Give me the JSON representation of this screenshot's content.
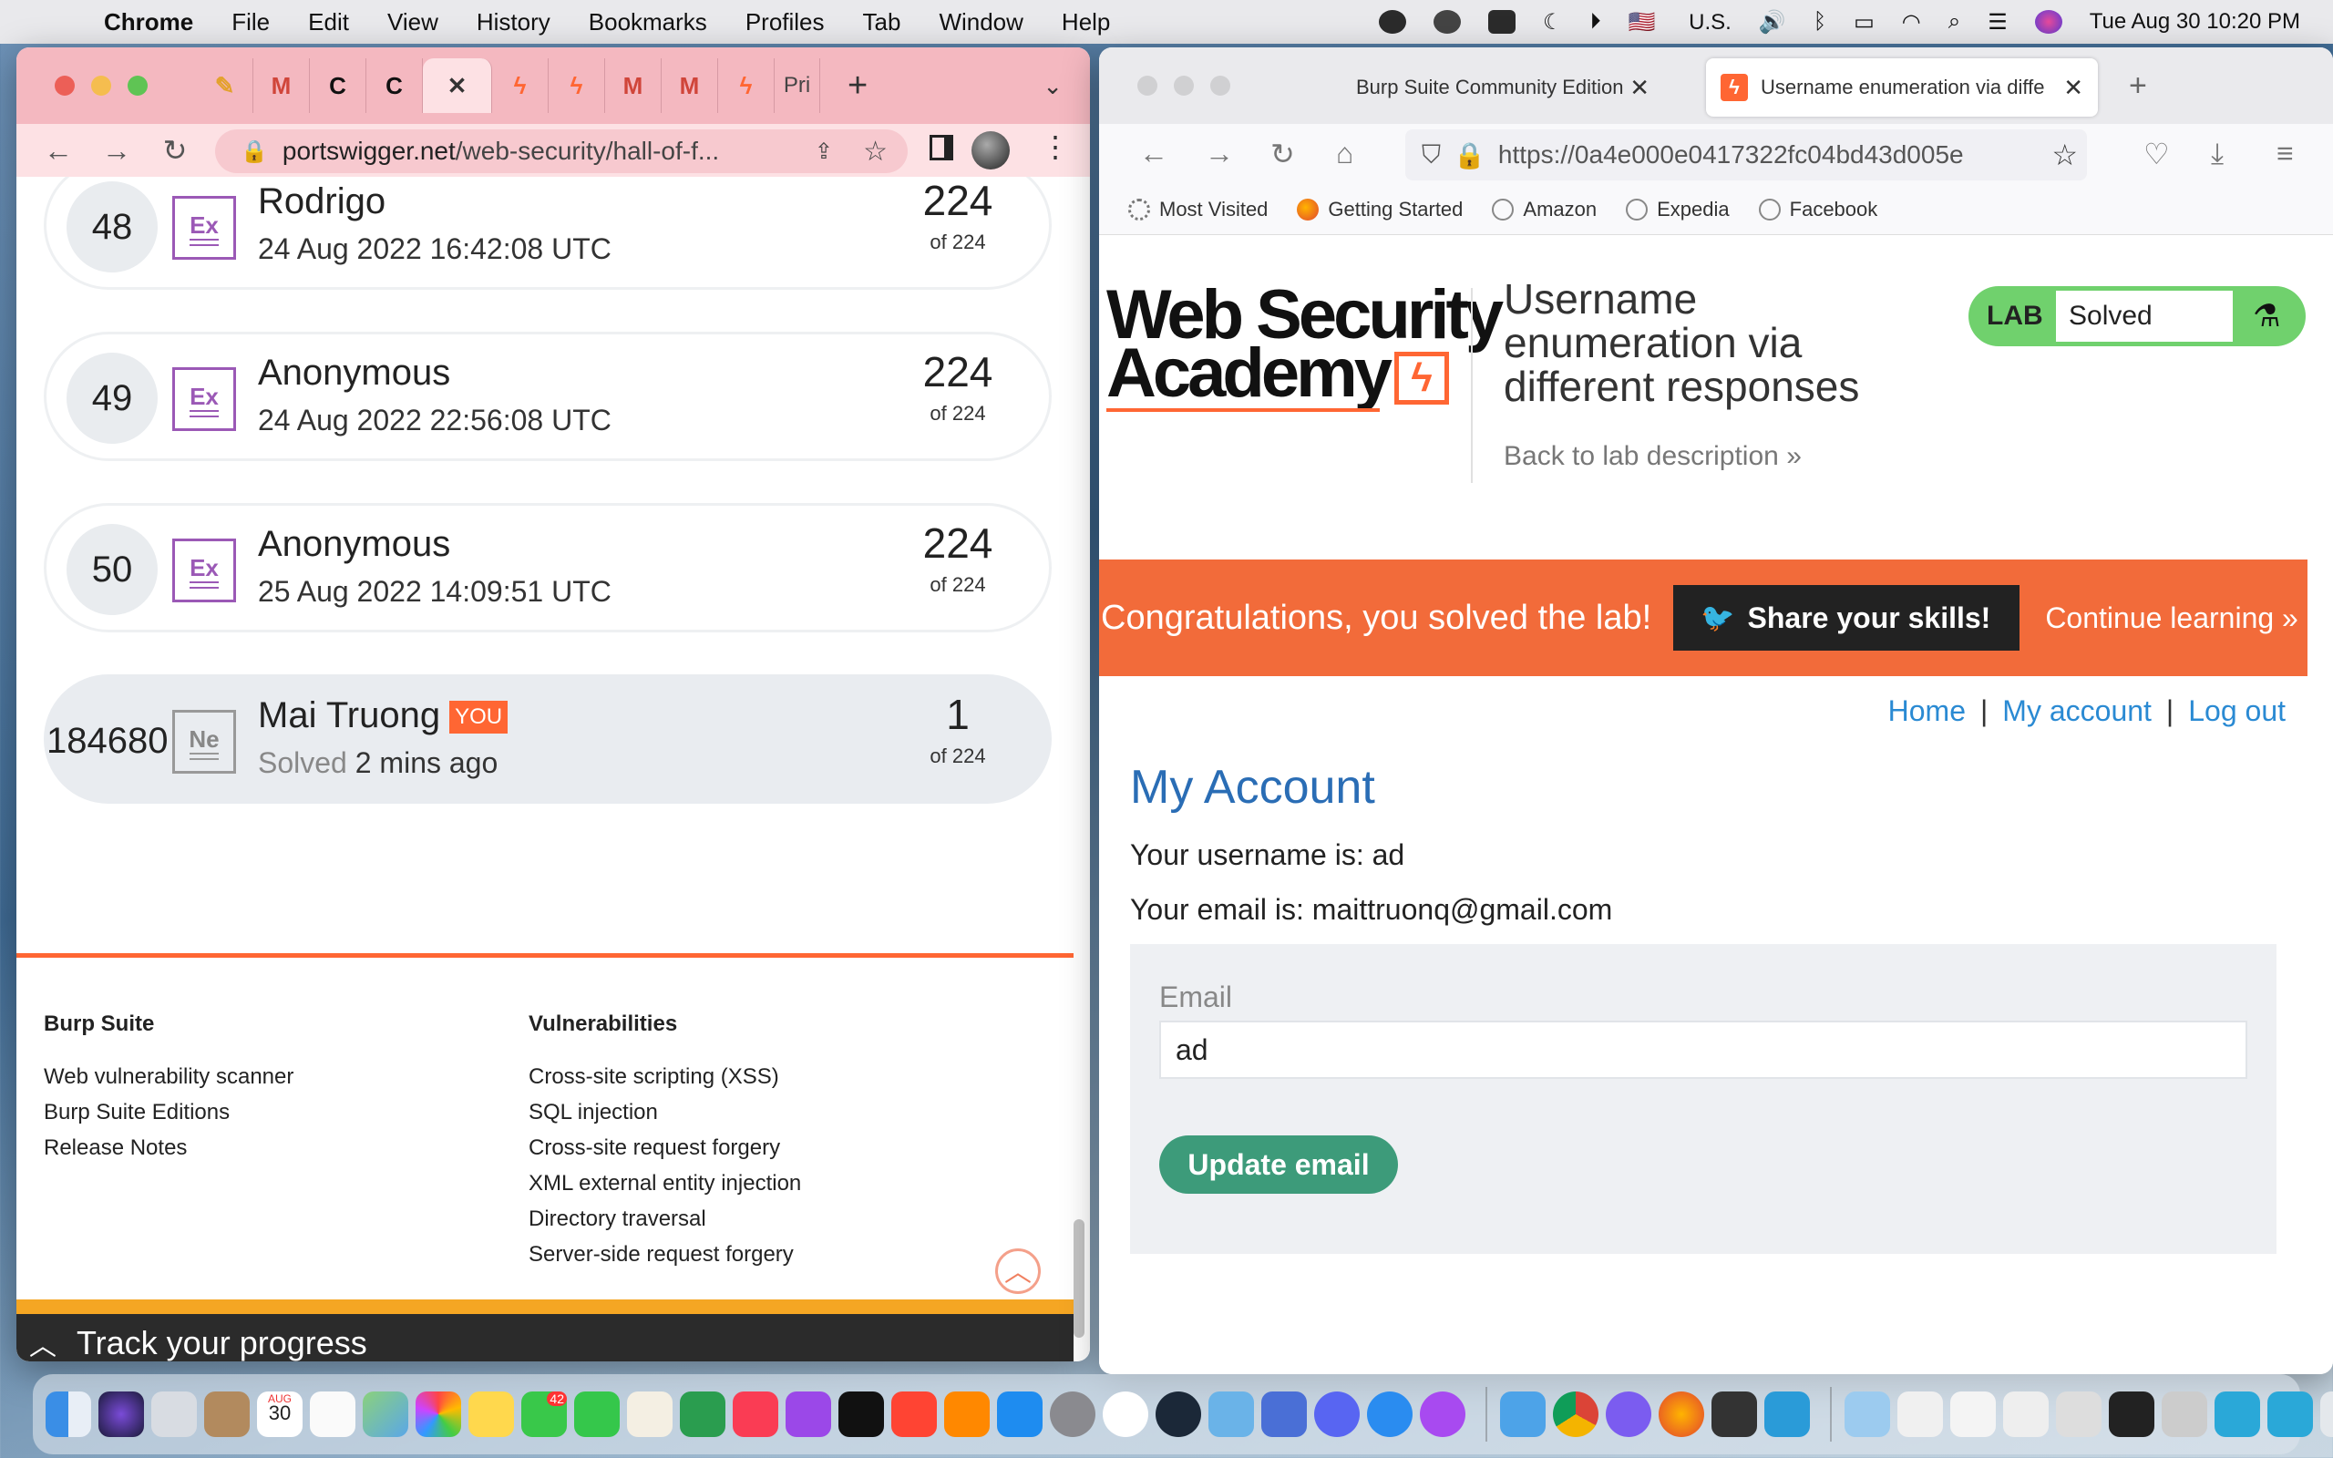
{
  "menubar": {
    "app": "Chrome",
    "items": [
      "File",
      "Edit",
      "View",
      "History",
      "Bookmarks",
      "Profiles",
      "Tab",
      "Window",
      "Help"
    ],
    "input_source": "U.S.",
    "clock": "Tue Aug 30  10:20 PM"
  },
  "chrome": {
    "tabs": [
      {
        "icon": "notes-icon",
        "glyph": "✎"
      },
      {
        "icon": "gmail-icon",
        "glyph": "M"
      },
      {
        "icon": "copyright-c-icon",
        "glyph": "C"
      },
      {
        "icon": "copyright-c-icon",
        "glyph": "C"
      },
      {
        "icon": "close-icon",
        "glyph": "✕",
        "active": true
      },
      {
        "icon": "portswigger-icon",
        "glyph": "ϟ"
      },
      {
        "icon": "portswigger-icon",
        "glyph": "ϟ"
      },
      {
        "icon": "gmail-icon",
        "glyph": "M"
      },
      {
        "icon": "gmail-icon",
        "glyph": "M"
      },
      {
        "icon": "portswigger-icon",
        "glyph": "ϟ"
      }
    ],
    "last_tab_label": "Pri",
    "url_host": "portswigger.net",
    "url_path": "/web-security/hall-of-f..."
  },
  "hall_of_fame": {
    "rows": [
      {
        "rank": "48",
        "badge": "Ex",
        "name": "Rodrigo",
        "date": "24 Aug 2022 16:42:08 UTC",
        "score": "224",
        "of": "of 224"
      },
      {
        "rank": "49",
        "badge": "Ex",
        "name": "Anonymous",
        "date": "24 Aug 2022 22:56:08 UTC",
        "score": "224",
        "of": "of 224"
      },
      {
        "rank": "50",
        "badge": "Ex",
        "name": "Anonymous",
        "date": "25 Aug 2022 14:09:51 UTC",
        "score": "224",
        "of": "of 224"
      }
    ],
    "you_row": {
      "rank": "184680",
      "badge": "Ne",
      "name": "Mai Truong",
      "tag": "YOU",
      "solved_prefix": "Solved",
      "solved_time": "2 mins ago",
      "score": "1",
      "of": "of 224"
    }
  },
  "footer": {
    "col1": {
      "title": "Burp Suite",
      "links": [
        "Web vulnerability scanner",
        "Burp Suite Editions",
        "Release Notes"
      ]
    },
    "col2": {
      "title": "Vulnerabilities",
      "links": [
        "Cross-site scripting (XSS)",
        "SQL injection",
        "Cross-site request forgery",
        "XML external entity injection",
        "Directory traversal",
        "Server-side request forgery"
      ]
    },
    "track_label": "Track your progress"
  },
  "firefox": {
    "tab1": "Burp Suite Community Edition",
    "tab2": "Username enumeration via diffe",
    "url": "https://0a4e000e0417322fc04bd43d005e",
    "bookmarks": [
      "Most Visited",
      "Getting Started",
      "Amazon",
      "Expedia",
      "Facebook"
    ]
  },
  "lab": {
    "logo_line1": "Web Security",
    "logo_line2": "Academy",
    "title": "Username enumeration via different responses",
    "back_link": "Back to lab description",
    "status_label": "LAB",
    "status_value": "Solved",
    "congrats": "Congratulations, you solved the lab!",
    "share": "Share your skills!",
    "continue": "Continue learning",
    "nav": {
      "home": "Home",
      "account": "My account",
      "logout": "Log out"
    },
    "heading": "My Account",
    "username_line": "Your username is: ad",
    "email_line": "Your email is: maittruonq@gmail.com",
    "email_label": "Email",
    "email_value": "ad",
    "update_button": "Update email"
  },
  "colors": {
    "portswigger_orange": "#ff6633",
    "lab_green": "#70d16d",
    "update_green": "#3d9b7a",
    "link_blue": "#2a8ad3",
    "chrome_pink": "#f4b8c0"
  },
  "dock": {
    "calendar_month": "AUG",
    "calendar_day": "30",
    "messages_badge": "42"
  }
}
